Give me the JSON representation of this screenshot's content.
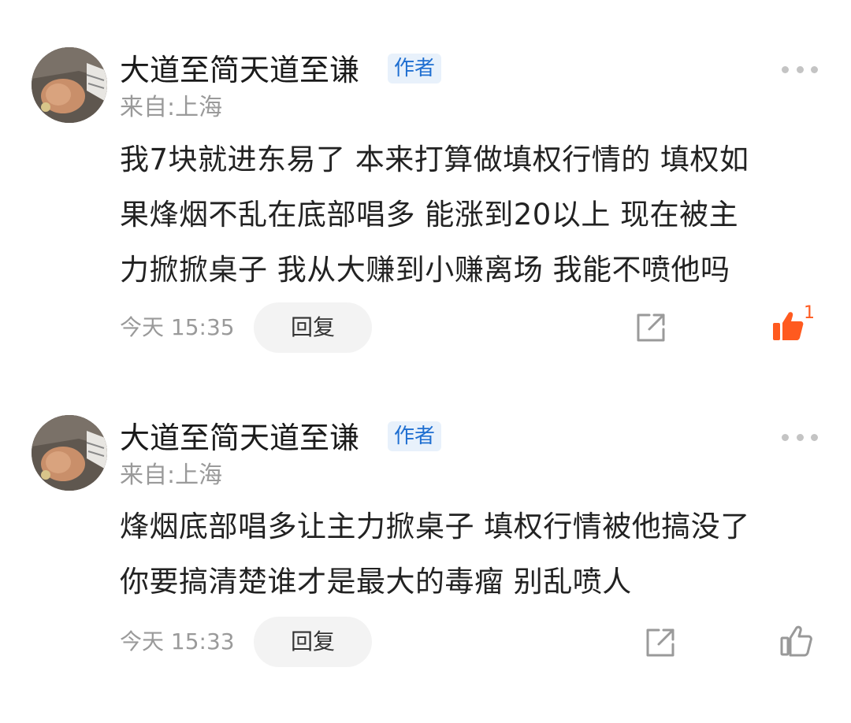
{
  "comments": [
    {
      "username": "大道至简天道至谦",
      "badge": "作者",
      "location": "来自:上海",
      "text": "我7块就进东易了 本来打算做填权行情的 填权如\n果烽烟不乱在底部唱多 能涨到20以上 现在被主\n力掀掀桌子 我从大赚到小赚离场 我能不喷他吗",
      "timestamp": "今天 15:35",
      "reply_label": "回复",
      "liked": true,
      "like_count": "1",
      "icons": {
        "more": "more-dots-icon",
        "share": "share-external-icon",
        "like": "thumbs-up-icon"
      },
      "colors": {
        "like_active": "#FF5A1F"
      }
    },
    {
      "username": "大道至简天道至谦",
      "badge": "作者",
      "location": "来自:上海",
      "text": "烽烟底部唱多让主力掀桌子 填权行情被他搞没了\n你要搞清楚谁才是最大的毒瘤 别乱喷人",
      "timestamp": "今天 15:33",
      "reply_label": "回复",
      "liked": false,
      "like_count": "",
      "icons": {
        "more": "more-dots-icon",
        "share": "share-external-icon",
        "like": "thumbs-up-icon"
      },
      "colors": {
        "like_inactive": "#999999"
      }
    }
  ],
  "colors": {
    "badge_text": "#1F6FD1",
    "badge_bg": "#E8F1FB",
    "secondary_text": "#9A9A9A",
    "reply_bg": "#F3F3F3"
  }
}
